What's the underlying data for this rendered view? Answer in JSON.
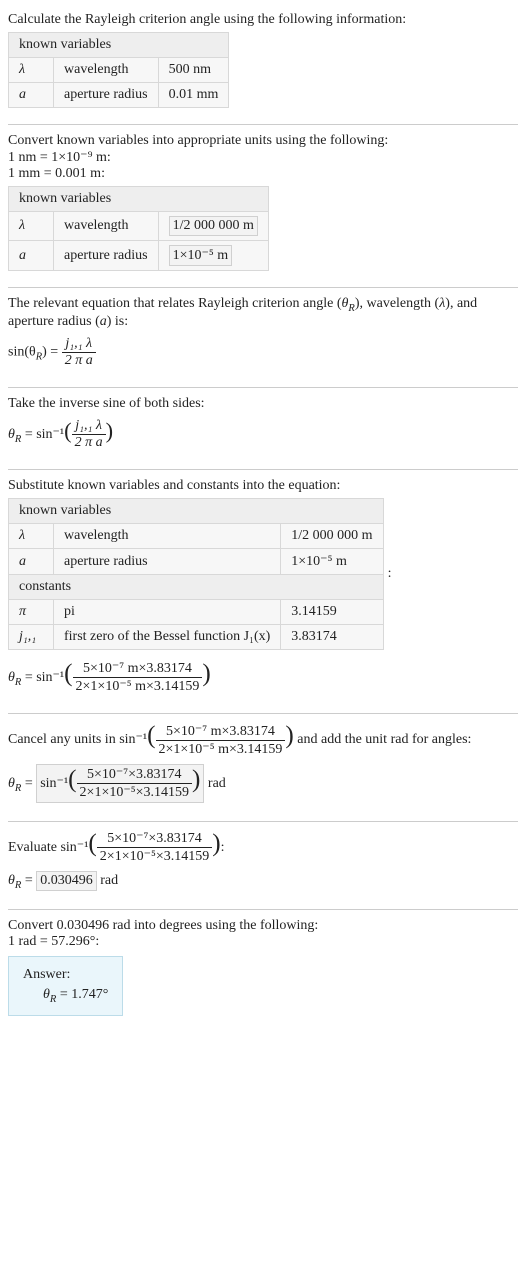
{
  "sec1": {
    "title": "Calculate the Rayleigh criterion angle using the following information:",
    "known_hdr": "known variables",
    "rows": [
      {
        "sym": "λ",
        "name": "wavelength",
        "val": "500 nm"
      },
      {
        "sym": "a",
        "name": "aperture radius",
        "val": "0.01 mm"
      }
    ]
  },
  "sec2": {
    "title": "Convert known variables into appropriate units using the following:",
    "conv1": "1 nm = 1×10⁻⁹ m:",
    "conv2": "1 mm = 0.001 m:",
    "known_hdr": "known variables",
    "rows": [
      {
        "sym": "λ",
        "name": "wavelength",
        "val": "1/2 000 000 m"
      },
      {
        "sym": "a",
        "name": "aperture radius",
        "val": "1×10⁻⁵ m"
      }
    ]
  },
  "sec3": {
    "title_a": "The relevant equation that relates Rayleigh criterion angle (",
    "theta": "θ",
    "rsub": "R",
    "title_b": "), wavelength (",
    "lambda": "λ",
    "title_c": "), and aperture radius (",
    "a": "a",
    "title_d": ") is:",
    "lhs": "sin(θ",
    "eq": ") = ",
    "num": "j₁,₁ λ",
    "den": "2 π a"
  },
  "sec4": {
    "title": "Take the inverse sine of both sides:",
    "lhs": "θ",
    "rsub": "R",
    "eq": " = sin⁻¹",
    "num": "j₁,₁ λ",
    "den": "2 π a"
  },
  "sec5": {
    "title": "Substitute known variables and constants into the equation:",
    "known_hdr": "known variables",
    "rows": [
      {
        "sym": "λ",
        "name": "wavelength",
        "val": "1/2 000 000 m"
      },
      {
        "sym": "a",
        "name": "aperture radius",
        "val": "1×10⁻⁵ m"
      }
    ],
    "const_hdr": "constants",
    "const_rows": [
      {
        "sym": "π",
        "name": "pi",
        "val": "3.14159"
      },
      {
        "sym": "j₁,₁",
        "name": "first zero of the Bessel function J₁(x)",
        "val": "3.83174"
      }
    ],
    "colon": ":",
    "lhs": "θ",
    "rsub": "R",
    "eq": " = sin⁻¹",
    "num": "5×10⁻⁷ m×3.83174",
    "den": "2×1×10⁻⁵ m×3.14159"
  },
  "sec6": {
    "title_a": "Cancel any units in sin⁻¹",
    "num_t": "5×10⁻⁷ m×3.83174",
    "den_t": "2×1×10⁻⁵ m×3.14159",
    "title_b": " and add the unit rad for angles:",
    "lhs": "θ",
    "rsub": "R",
    "eq": " = ",
    "box_pre": "sin⁻¹",
    "num": "5×10⁻⁷×3.83174",
    "den": "2×1×10⁻⁵×3.14159",
    "unit": " rad"
  },
  "sec7": {
    "title_a": "Evaluate sin⁻¹",
    "num_t": "5×10⁻⁷×3.83174",
    "den_t": "2×1×10⁻⁵×3.14159",
    "title_b": ":",
    "lhs": "θ",
    "rsub": "R",
    "eq": " = ",
    "val": "0.030496",
    "unit": " rad"
  },
  "sec8": {
    "title": "Convert 0.030496 rad into degrees using the following:",
    "conv": "1 rad = 57.296°:",
    "answer_label": "Answer:",
    "lhs": "θ",
    "rsub": "R",
    "eq": " = 1.747°"
  }
}
